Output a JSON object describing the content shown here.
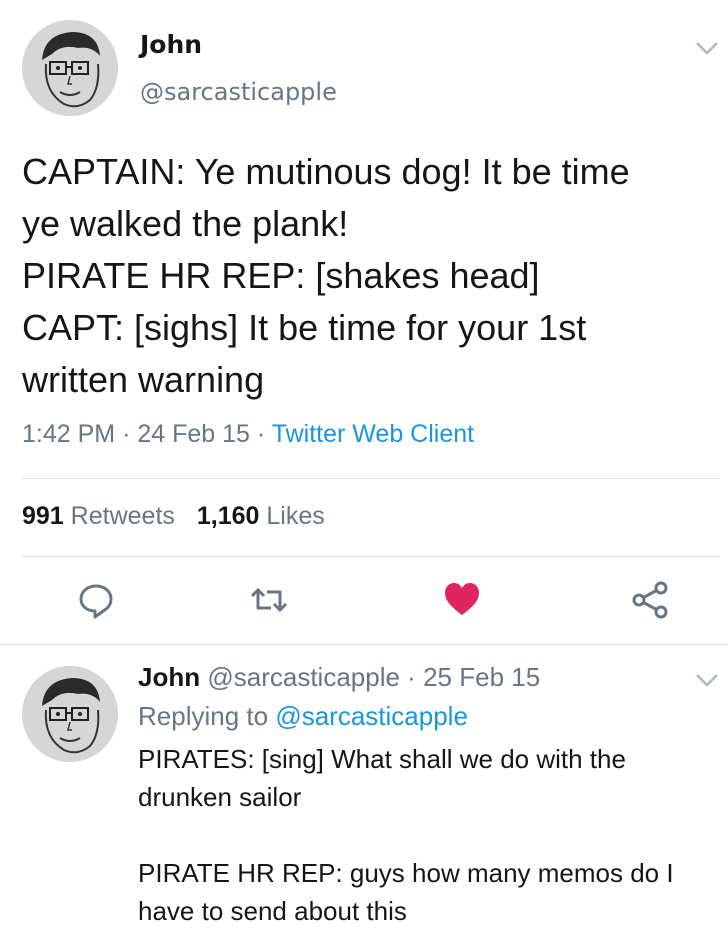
{
  "main_tweet": {
    "author_name": "John",
    "handle": "@sarcasticapple",
    "avatar_icon": "sketched-face-avatar",
    "text": "CAPTAIN: Ye mutinous dog! It be time\nye walked the plank!\nPIRATE HR REP: [shakes head]\nCAPT: [sighs] It be time for your 1st\nwritten warning",
    "time": "1:42 PM",
    "date": "24 Feb 15",
    "separator": "·",
    "client": "Twitter Web Client",
    "retweets_count": "991",
    "retweets_label": "Retweets",
    "likes_count": "1,160",
    "likes_label": "Likes",
    "actions": [
      "reply-icon",
      "retweet-icon",
      "like-icon",
      "share-icon"
    ],
    "like_color": "#e0245e",
    "link_color": "#1b95e0"
  },
  "reply_tweet": {
    "author_name": "John",
    "handle": "@sarcasticapple",
    "separator": "·",
    "date": "25 Feb 15",
    "replying_label": "Replying to",
    "replying_to": "@sarcasticapple",
    "text": "PIRATES: [sing] What shall we do with the\ndrunken sailor\n\nPIRATE HR REP: guys how many memos do I\nhave to send about this"
  }
}
